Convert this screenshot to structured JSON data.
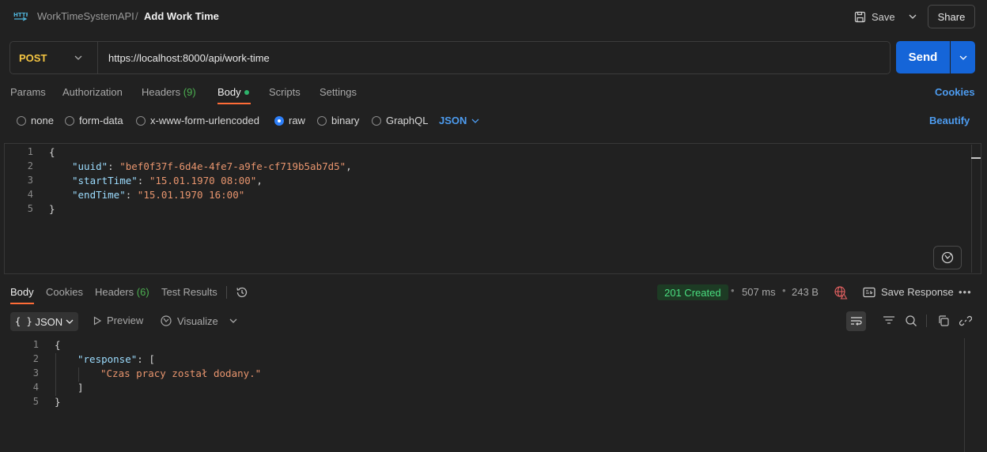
{
  "header": {
    "collection": "WorkTimeSystemAPI",
    "separator": "/",
    "title": "Add Work Time",
    "save_label": "Save",
    "share_label": "Share"
  },
  "request": {
    "method": "POST",
    "url": "https://localhost:8000/api/work-time",
    "send_label": "Send"
  },
  "request_tabs": {
    "params": "Params",
    "authorization": "Authorization",
    "headers": "Headers",
    "headers_count": "(9)",
    "body": "Body",
    "scripts": "Scripts",
    "settings": "Settings",
    "cookies": "Cookies"
  },
  "body_types": {
    "none": "none",
    "form_data": "form-data",
    "urlencoded": "x-www-form-urlencoded",
    "raw": "raw",
    "binary": "binary",
    "graphql": "GraphQL",
    "format": "JSON",
    "beautify": "Beautify"
  },
  "request_body": {
    "line_numbers": [
      "1",
      "2",
      "3",
      "4",
      "5"
    ],
    "open": "{",
    "close": "}",
    "fields": [
      {
        "key": "\"uuid\"",
        "value": "\"bef0f37f-6d4e-4fe7-a9fe-cf719b5ab7d5\"",
        "trail": ","
      },
      {
        "key": "\"startTime\"",
        "value": "\"15.01.1970 08:00\"",
        "trail": ","
      },
      {
        "key": "\"endTime\"",
        "value": "\"15.01.1970 16:00\"",
        "trail": ""
      }
    ]
  },
  "response_tabs": {
    "body": "Body",
    "cookies": "Cookies",
    "headers": "Headers",
    "headers_count": "(6)",
    "test_results": "Test Results"
  },
  "response_meta": {
    "status": "201 Created",
    "time": "507 ms",
    "size": "243 B",
    "save_response": "Save Response",
    "status_color": "#4ade80"
  },
  "response_toolbar": {
    "format": "JSON",
    "preview": "Preview",
    "visualize": "Visualize"
  },
  "response_body": {
    "line_numbers": [
      "1",
      "2",
      "3",
      "4",
      "5"
    ],
    "open": "{",
    "key": "\"response\"",
    "array_open": "[",
    "item": "\"Czas pracy został dodany.\"",
    "array_close": "]",
    "close": "}"
  },
  "colors": {
    "accent_orange": "#ff6c37",
    "send_blue": "#1565d8",
    "link_blue": "#4d9cf0",
    "method_yellow": "#f4c542"
  }
}
